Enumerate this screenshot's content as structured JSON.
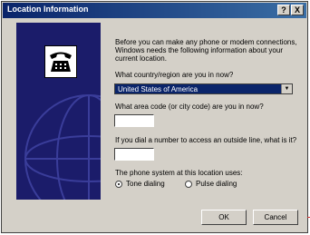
{
  "title": "Location Information",
  "help_button": "?",
  "close_button": "X",
  "intro": "Before you can make any phone or modem connections, Windows needs the following information about your current location.",
  "country_label": "What country/region are you in now?",
  "country_value": "United States of America",
  "area_code_label": "What area code (or city code) are you in now?",
  "area_code_value": "",
  "outside_line_label": "If you dial a number to access an outside line, what is it?",
  "outside_line_value": "",
  "phone_system_label": "The phone system at this location uses:",
  "tone_label": "Tone dialing",
  "pulse_label": "Pulse dialing",
  "tone_selected": true,
  "ok_label": "OK",
  "cancel_label": "Cancel",
  "icons": [
    "telephone-icon",
    "globe-graphic",
    "chevron-down-icon"
  ],
  "colors": {
    "titlebar": "#0a246a",
    "sidebar": "#1b1c6a",
    "face": "#d4d0c8",
    "selection": "#0a246a"
  }
}
